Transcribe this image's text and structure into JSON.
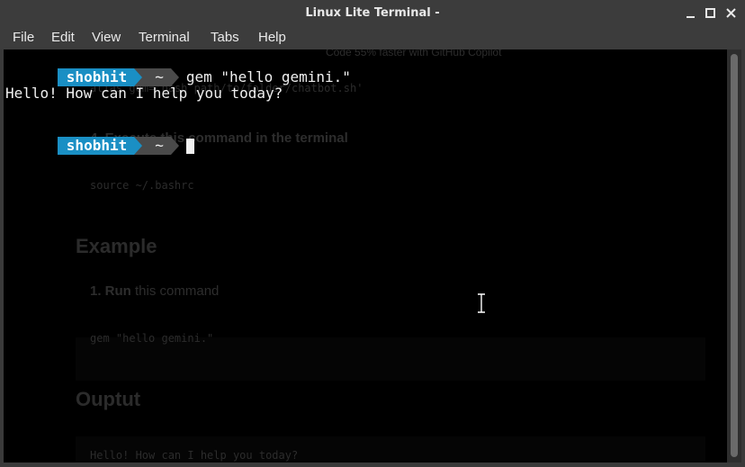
{
  "window": {
    "title": "Linux Lite Terminal -"
  },
  "menu": [
    "File",
    "Edit",
    "View",
    "Terminal",
    "Tabs",
    "Help"
  ],
  "prompt": {
    "user": "shobhit",
    "dir": "~"
  },
  "lines": [
    {
      "command": "gem \"hello gemini.\""
    },
    {
      "output": "Hello! How can I help you today?"
    }
  ],
  "background_ghost": {
    "banner": "Code 55% faster with GitHub Copilot",
    "alias": "alias gem='bash path/to/folder/chatbot.sh'",
    "step4": "4. Execute this command in the terminal",
    "source": "source ~/.bashrc",
    "example_heading": "Example",
    "step1_num": "1. Run",
    "step1_rest": " this command",
    "example_cmd": "gem \"hello gemini.\"",
    "output_heading": "Ouptut",
    "output_text": "Hello! How can I help you today?"
  },
  "colors": {
    "prompt_user_bg": "#1a8fc4",
    "prompt_dir_bg": "#4a4a4a",
    "terminal_bg": "#000000"
  }
}
